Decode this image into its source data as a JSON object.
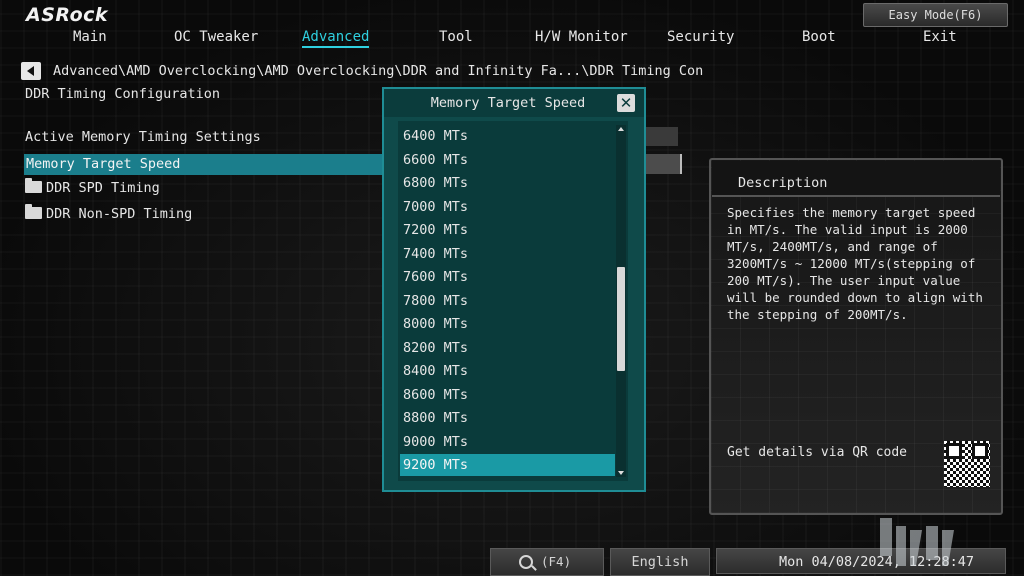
{
  "brand": {
    "logo_text": "ASRock"
  },
  "easy_mode_label": "Easy Mode(F6)",
  "nav": {
    "items": [
      {
        "label": "Main",
        "active": false
      },
      {
        "label": "OC Tweaker",
        "active": false
      },
      {
        "label": "Advanced",
        "active": true
      },
      {
        "label": "Tool",
        "active": false
      },
      {
        "label": "H/W Monitor",
        "active": false
      },
      {
        "label": "Security",
        "active": false
      },
      {
        "label": "Boot",
        "active": false
      },
      {
        "label": "Exit",
        "active": false
      }
    ]
  },
  "breadcrumb": "Advanced\\AMD Overclocking\\AMD Overclocking\\DDR and Infinity Fa...\\DDR Timing Con",
  "page_title": "DDR Timing Configuration",
  "settings": {
    "section_label": "Active Memory Timing Settings",
    "selected_item": "Memory Target Speed",
    "folders": [
      "DDR SPD Timing",
      "DDR Non-SPD Timing"
    ]
  },
  "dialog": {
    "title": "Memory Target Speed",
    "options": [
      "6400 MTs",
      "6600 MTs",
      "6800 MTs",
      "7000 MTs",
      "7200 MTs",
      "7400 MTs",
      "7600 MTs",
      "7800 MTs",
      "8000 MTs",
      "8200 MTs",
      "8400 MTs",
      "8600 MTs",
      "8800 MTs",
      "9000 MTs",
      "9200 MTs"
    ],
    "selected_option": "9200 MTs"
  },
  "description": {
    "title": "Description",
    "text": "Specifies the memory target speed in MT/s. The valid input is 2000 MT/s, 2400MT/s, and range of 3200MT/s ~ 12000 MT/s(stepping of 200 MT/s). The user input value will be rounded down to align with the stepping of 200MT/s.",
    "qr_label": "Get details via QR code"
  },
  "bottom_bar": {
    "search_key": "(F4)",
    "language": "English",
    "datetime": "Mon 04/08/2024, 12:28:47"
  }
}
